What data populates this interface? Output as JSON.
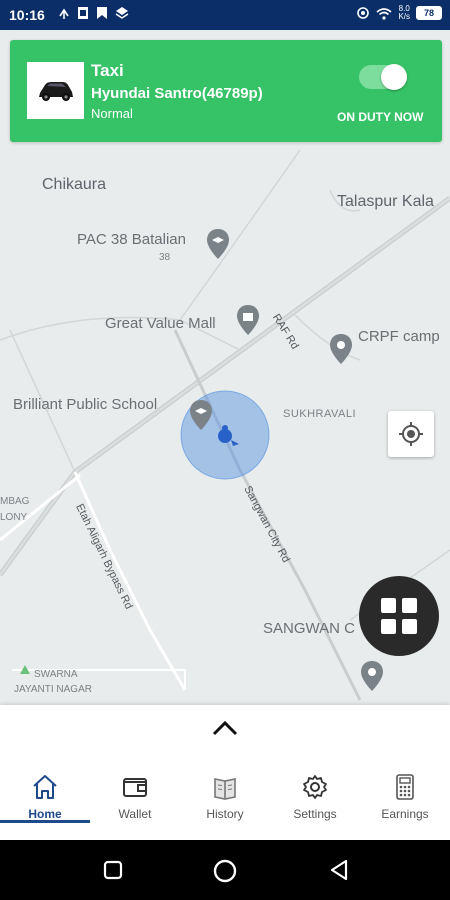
{
  "status_bar": {
    "time": "10:16",
    "net_speed_value": "8.0",
    "net_speed_unit": "K/s",
    "battery": "78"
  },
  "duty_card": {
    "service_type": "Taxi",
    "vehicle": "Hyundai Santro(46789p)",
    "category": "Normal",
    "duty_status": "ON DUTY NOW",
    "toggle_on": true,
    "color": "#36c267"
  },
  "map": {
    "places": {
      "chikaura": "Chikaura",
      "talaspur": "Talaspur Kala",
      "pac": "PAC 38 Batalian",
      "pac_sub": "38",
      "mall": "Great Value Mall",
      "crpf": "CRPF camp",
      "school": "Brilliant Public School",
      "sukhravali": "SUKHRAVALI",
      "ambag1": "MBAG",
      "ambag2": "LONY",
      "sangwan": "SANGWAN C",
      "swarna1": "SWARNA",
      "swarna2": "JAYANTI NAGAR"
    },
    "roads": {
      "raf": "RAF Rd",
      "sangwan_city": "Sangwan City Rd",
      "etah": "Etah Aligarh Bypass Rd"
    }
  },
  "bottom_nav": {
    "items": [
      {
        "label": "Home",
        "icon": "home-icon",
        "active": true
      },
      {
        "label": "Wallet",
        "icon": "wallet-icon"
      },
      {
        "label": "History",
        "icon": "history-icon"
      },
      {
        "label": "Settings",
        "icon": "settings-icon"
      },
      {
        "label": "Earnings",
        "icon": "earnings-icon"
      }
    ]
  },
  "colors": {
    "status_bar": "#0b2e68",
    "accent": "#1e4a8c",
    "location_circle": "#4f8fe0"
  }
}
